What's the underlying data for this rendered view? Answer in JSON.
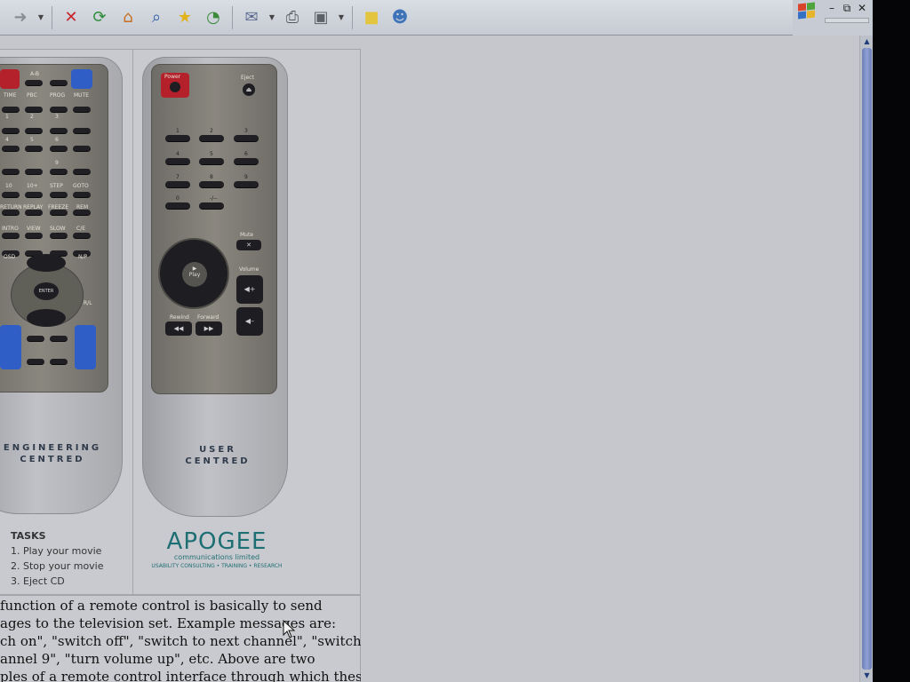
{
  "toolbar": {
    "buttons": [
      {
        "name": "back-icon",
        "glyph": "➜",
        "color": "#8a8d93"
      },
      {
        "name": "stop-icon",
        "glyph": "✕",
        "color": "#c8262b"
      },
      {
        "name": "refresh-icon",
        "glyph": "⟳",
        "color": "#2e8b3a"
      },
      {
        "name": "home-icon",
        "glyph": "⌂",
        "color": "#c76d1f"
      },
      {
        "name": "search-icon",
        "glyph": "⌕",
        "color": "#2d5ea8"
      },
      {
        "name": "favorites-icon",
        "glyph": "★",
        "color": "#e0b21c"
      },
      {
        "name": "history-icon",
        "glyph": "◔",
        "color": "#3a8a3a"
      },
      {
        "name": "mail-icon",
        "glyph": "✉",
        "color": "#5b6c90"
      },
      {
        "name": "print-icon",
        "glyph": "⎙",
        "color": "#55595f"
      },
      {
        "name": "edit-icon",
        "glyph": "▣",
        "color": "#5e6167"
      },
      {
        "name": "notes-icon",
        "glyph": "■",
        "color": "#e3c540"
      },
      {
        "name": "messenger-icon",
        "glyph": "☻",
        "color": "#3f73b9"
      }
    ]
  },
  "remote_left": {
    "brand_line1": "ENGINEERING",
    "brand_line2": "CENTRED",
    "labels": [
      "A-B",
      "TIME",
      "PBC",
      "PROG",
      "MUTE",
      "1",
      "2",
      "3",
      "4",
      "5",
      "6",
      "9",
      "10",
      "10+",
      "STEP",
      "GOTO",
      "RETURN",
      "REPLAY",
      "FREEZE",
      "REM",
      "INTRO",
      "VIEW",
      "SLOW",
      "C/E",
      "OSD",
      "N/P",
      "ENTER",
      "R/L"
    ]
  },
  "remote_right": {
    "power_label": "Power",
    "eject_label": "Eject",
    "mute_label": "Mute",
    "volume_label": "Volume",
    "rewind_label": "Rewind",
    "forward_label": "Forward",
    "play_label": "Play",
    "numbers": [
      "1",
      "2",
      "3",
      "4",
      "5",
      "6",
      "7",
      "8",
      "9",
      "0",
      "-/--"
    ],
    "brand_line1": "USER",
    "brand_line2": "CENTRED"
  },
  "tasks": {
    "title": "TASKS",
    "items": [
      "1. Play your movie",
      "2. Stop your movie",
      "3. Eject CD"
    ]
  },
  "apogee": {
    "name": "APOGEE",
    "subtitle": "communications limited",
    "tagline": "USABILITY CONSULTING • TRAINING • RESEARCH"
  },
  "body_text": [
    "function of a remote control is basically to send",
    "ages to the television set. Example messages are:",
    "ch on\", \"switch off\", \"switch to next channel\", \"switch",
    "annel 9\", \"turn volume up\", etc. Above are two",
    "ples of a remote control interface through which these"
  ]
}
